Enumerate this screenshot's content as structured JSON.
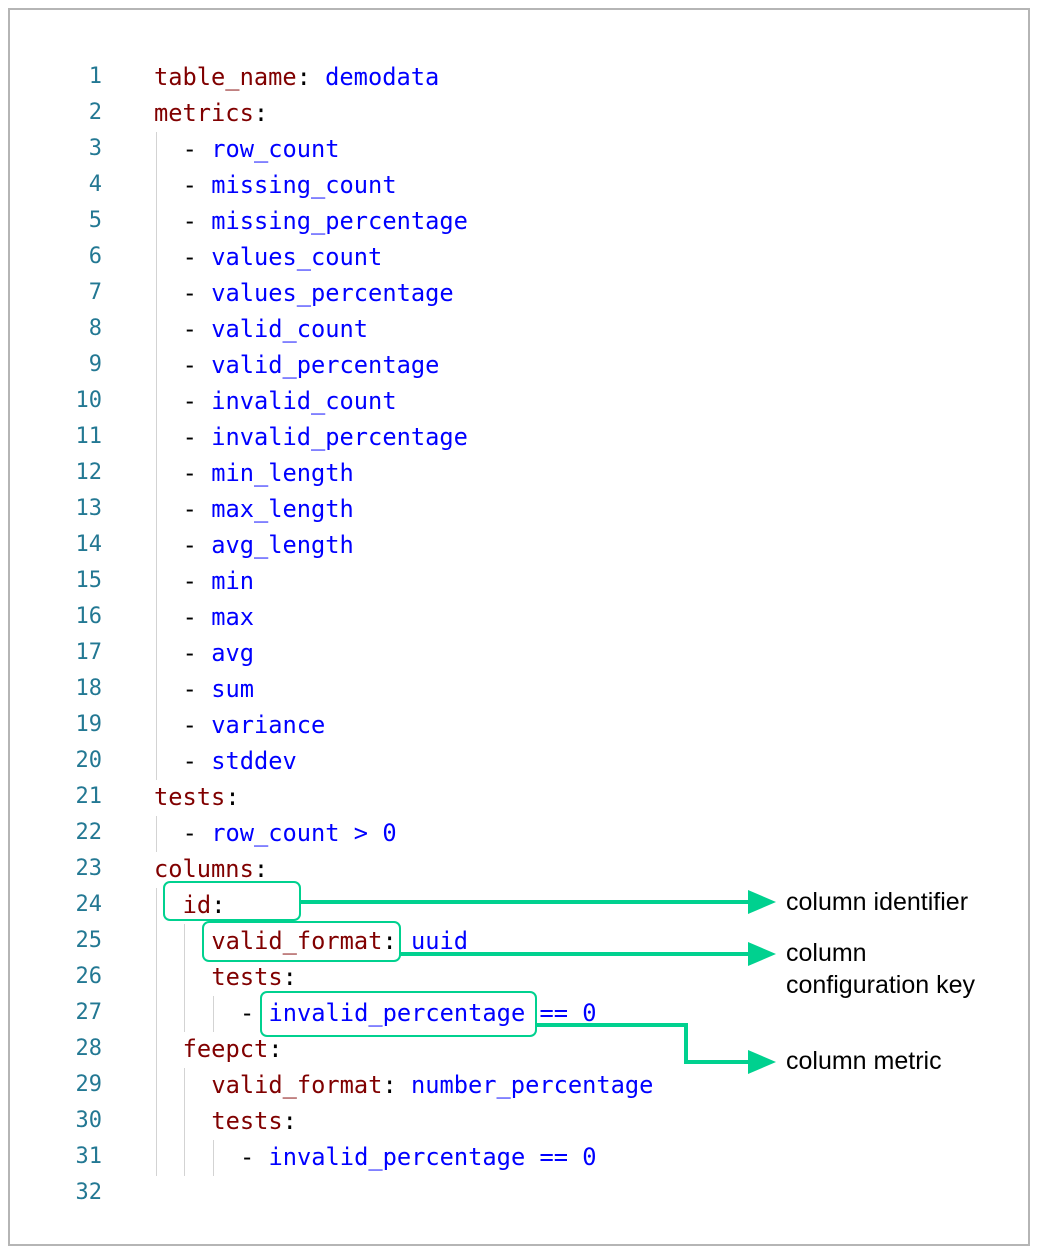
{
  "lines": [
    {
      "n": "1",
      "indent": 0,
      "dash": false,
      "key": "table_name",
      "colon": ":",
      "value": "demodata"
    },
    {
      "n": "2",
      "indent": 0,
      "dash": false,
      "key": "metrics",
      "colon": ":",
      "value": ""
    },
    {
      "n": "3",
      "indent": 1,
      "dash": true,
      "key": "",
      "colon": "",
      "value": "row_count"
    },
    {
      "n": "4",
      "indent": 1,
      "dash": true,
      "key": "",
      "colon": "",
      "value": "missing_count"
    },
    {
      "n": "5",
      "indent": 1,
      "dash": true,
      "key": "",
      "colon": "",
      "value": "missing_percentage"
    },
    {
      "n": "6",
      "indent": 1,
      "dash": true,
      "key": "",
      "colon": "",
      "value": "values_count"
    },
    {
      "n": "7",
      "indent": 1,
      "dash": true,
      "key": "",
      "colon": "",
      "value": "values_percentage"
    },
    {
      "n": "8",
      "indent": 1,
      "dash": true,
      "key": "",
      "colon": "",
      "value": "valid_count"
    },
    {
      "n": "9",
      "indent": 1,
      "dash": true,
      "key": "",
      "colon": "",
      "value": "valid_percentage"
    },
    {
      "n": "10",
      "indent": 1,
      "dash": true,
      "key": "",
      "colon": "",
      "value": "invalid_count"
    },
    {
      "n": "11",
      "indent": 1,
      "dash": true,
      "key": "",
      "colon": "",
      "value": "invalid_percentage"
    },
    {
      "n": "12",
      "indent": 1,
      "dash": true,
      "key": "",
      "colon": "",
      "value": "min_length"
    },
    {
      "n": "13",
      "indent": 1,
      "dash": true,
      "key": "",
      "colon": "",
      "value": "max_length"
    },
    {
      "n": "14",
      "indent": 1,
      "dash": true,
      "key": "",
      "colon": "",
      "value": "avg_length"
    },
    {
      "n": "15",
      "indent": 1,
      "dash": true,
      "key": "",
      "colon": "",
      "value": "min"
    },
    {
      "n": "16",
      "indent": 1,
      "dash": true,
      "key": "",
      "colon": "",
      "value": "max"
    },
    {
      "n": "17",
      "indent": 1,
      "dash": true,
      "key": "",
      "colon": "",
      "value": "avg"
    },
    {
      "n": "18",
      "indent": 1,
      "dash": true,
      "key": "",
      "colon": "",
      "value": "sum"
    },
    {
      "n": "19",
      "indent": 1,
      "dash": true,
      "key": "",
      "colon": "",
      "value": "variance"
    },
    {
      "n": "20",
      "indent": 1,
      "dash": true,
      "key": "",
      "colon": "",
      "value": "stddev"
    },
    {
      "n": "21",
      "indent": 0,
      "dash": false,
      "key": "tests",
      "colon": ":",
      "value": ""
    },
    {
      "n": "22",
      "indent": 1,
      "dash": true,
      "key": "",
      "colon": "",
      "value": "row_count > 0"
    },
    {
      "n": "23",
      "indent": 0,
      "dash": false,
      "key": "columns",
      "colon": ":",
      "value": ""
    },
    {
      "n": "24",
      "indent": 1,
      "dash": false,
      "key": "id",
      "colon": ":",
      "value": ""
    },
    {
      "n": "25",
      "indent": 2,
      "dash": false,
      "key": "valid_format",
      "colon": ":",
      "value": "uuid"
    },
    {
      "n": "26",
      "indent": 2,
      "dash": false,
      "key": "tests",
      "colon": ":",
      "value": ""
    },
    {
      "n": "27",
      "indent": 3,
      "dash": true,
      "key": "",
      "colon": "",
      "value": "invalid_percentage == 0"
    },
    {
      "n": "28",
      "indent": 1,
      "dash": false,
      "key": "feepct",
      "colon": ":",
      "value": ""
    },
    {
      "n": "29",
      "indent": 2,
      "dash": false,
      "key": "valid_format",
      "colon": ":",
      "value": "number_percentage"
    },
    {
      "n": "30",
      "indent": 2,
      "dash": false,
      "key": "tests",
      "colon": ":",
      "value": ""
    },
    {
      "n": "31",
      "indent": 3,
      "dash": true,
      "key": "",
      "colon": "",
      "value": "invalid_percentage == 0"
    },
    {
      "n": "32",
      "indent": 0,
      "dash": false,
      "key": "",
      "colon": "",
      "value": ""
    }
  ],
  "annotations": {
    "column_identifier": "column identifier",
    "column_configuration_key_line1": "column",
    "column_configuration_key_line2": "configuration key",
    "column_metric": "column metric"
  },
  "colors": {
    "key": "#800000",
    "value": "#0000ff",
    "line_number": "#237893",
    "annotation": "#00d18f",
    "guide": "#d3d3d3",
    "frame": "#b5b5b5"
  }
}
